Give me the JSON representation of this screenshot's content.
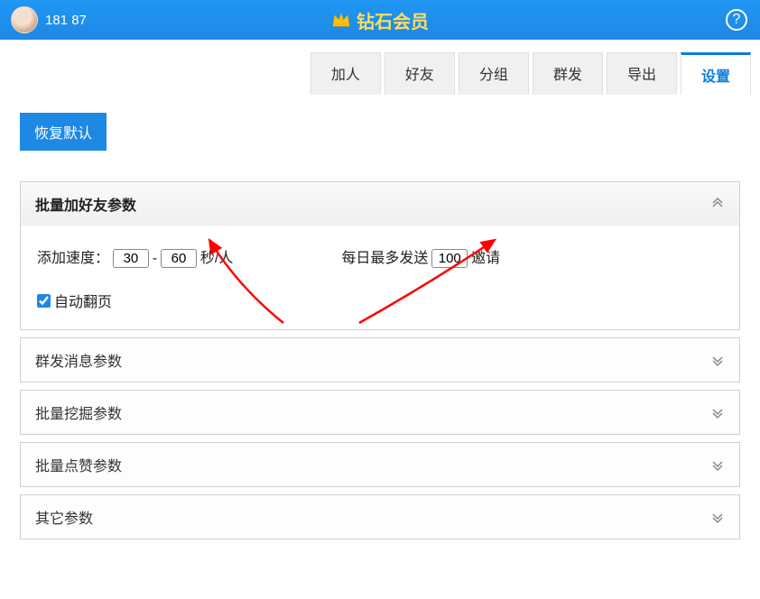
{
  "header": {
    "phone": "181            87",
    "title": "钻石会员"
  },
  "tabs": [
    "加人",
    "好友",
    "分组",
    "群发",
    "导出",
    "设置"
  ],
  "activeTab": "设置",
  "restoreLabel": "恢复默认",
  "panels": {
    "p0": {
      "title": "批量加好友参数",
      "addSpeedLabel": "添加速度：",
      "speedMin": "30",
      "speedMax": "60",
      "speedUnit": "秒/人",
      "dailyPrefix": "每日最多发送",
      "dailyMax": "100",
      "dailySuffix": "邀请",
      "autoFlipLabel": "自动翻页"
    },
    "p1": {
      "title": "群发消息参数"
    },
    "p2": {
      "title": "批量挖掘参数"
    },
    "p3": {
      "title": "批量点赞参数"
    },
    "p4": {
      "title": "其它参数"
    }
  }
}
